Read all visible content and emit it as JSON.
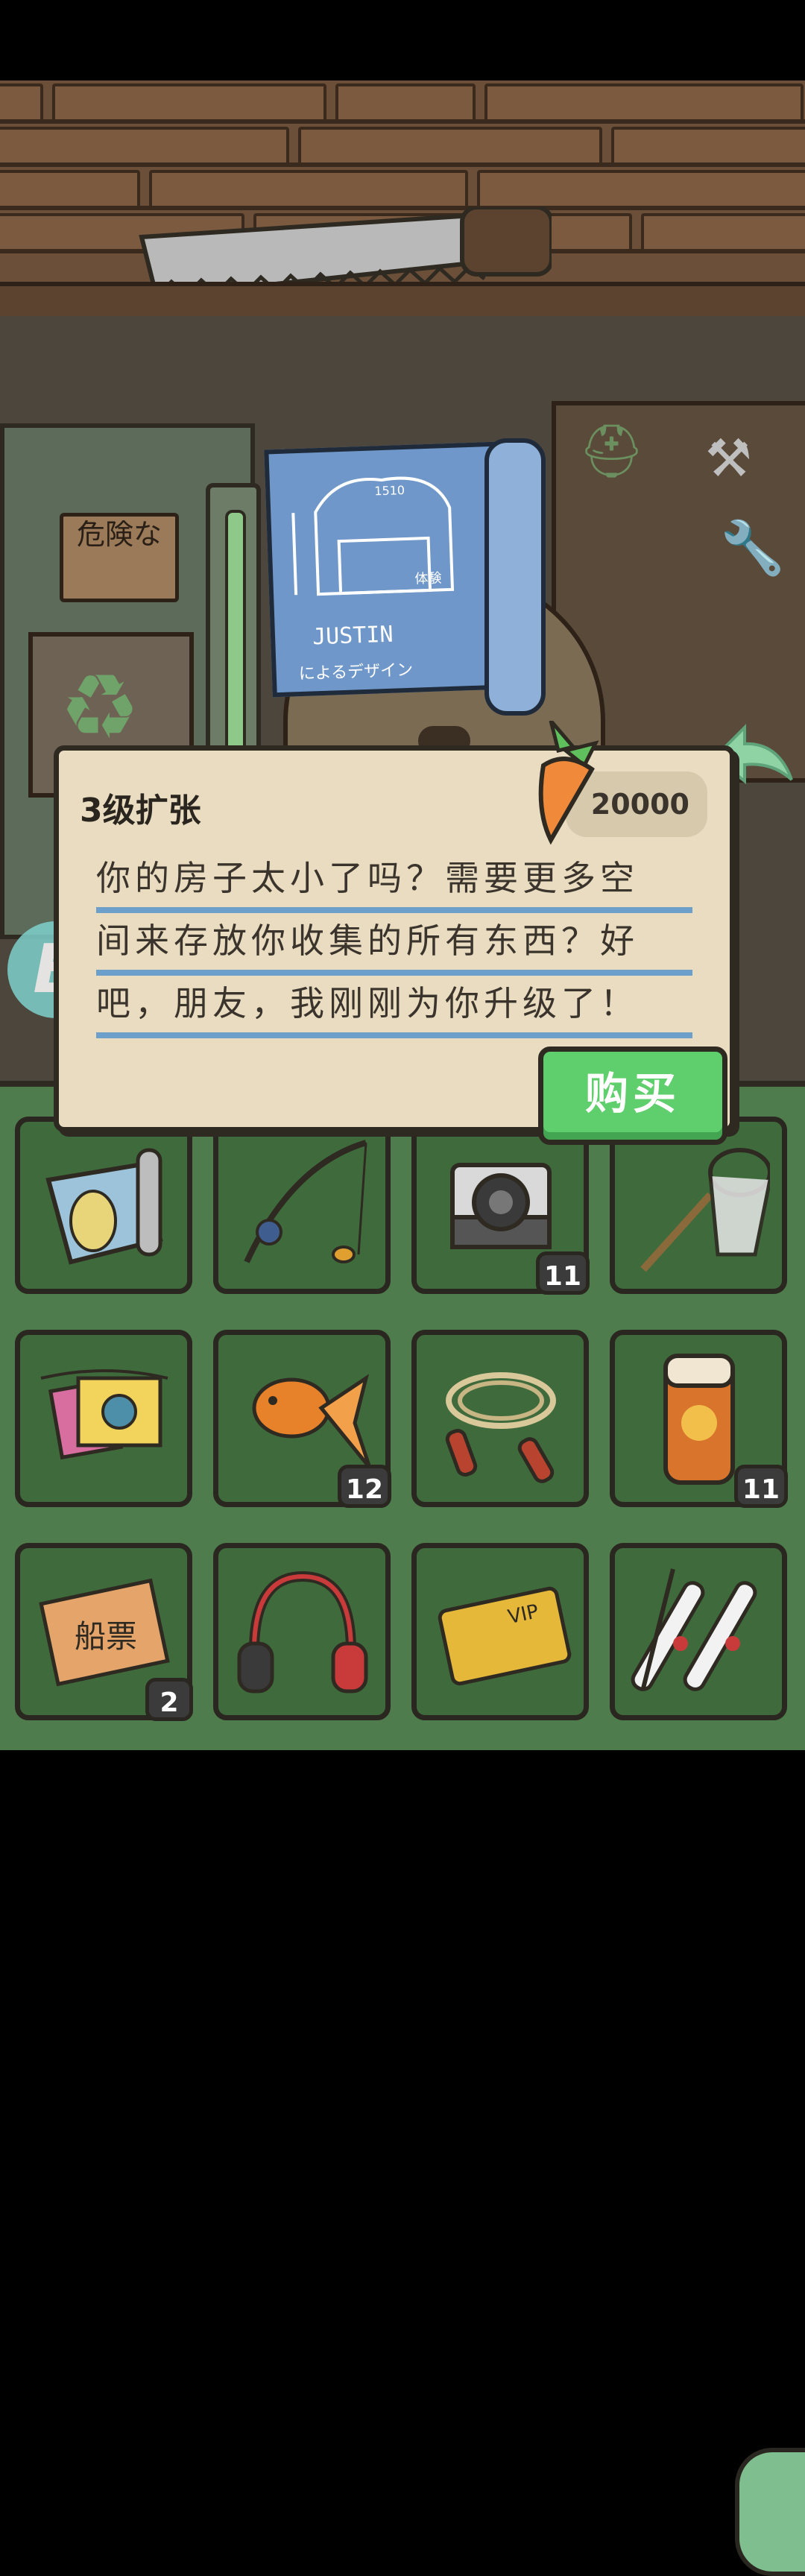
{
  "dialog": {
    "title": "3级扩张",
    "price": "20000",
    "description_lines": [
      "你的房子太小了吗？需要更多空",
      "间来存放你收集的所有东西？好",
      "吧，朋友，我刚刚为你升级了！"
    ],
    "buy_label": "购买"
  },
  "scene": {
    "danger_sign_text": "危険な",
    "blueprint_title": "JUSTIN",
    "blueprint_subtitle": "によるデザイン",
    "blueprint_label_1": "1510",
    "blueprint_note": "体験"
  },
  "overlay": {
    "e_badge": "E"
  },
  "inventory": {
    "slots": [
      {
        "name": "map-scroll",
        "icon": "map-icon",
        "count": ""
      },
      {
        "name": "fishing-rod",
        "icon": "fishing-rod-icon",
        "count": ""
      },
      {
        "name": "instant-camera",
        "icon": "camera-icon",
        "count": "11"
      },
      {
        "name": "bug-net",
        "icon": "bug-net-icon",
        "count": ""
      },
      {
        "name": "bunting-flags",
        "icon": "bunting-icon",
        "count": ""
      },
      {
        "name": "goldfish",
        "icon": "goldfish-icon",
        "count": "12"
      },
      {
        "name": "jump-rope",
        "icon": "jump-rope-icon",
        "count": ""
      },
      {
        "name": "sunscreen",
        "icon": "sunscreen-icon",
        "count": "11"
      },
      {
        "name": "boat-ticket",
        "icon": "ticket-icon",
        "count": "2",
        "text": "船票"
      },
      {
        "name": "headphones",
        "icon": "headphones-icon",
        "count": ""
      },
      {
        "name": "vip-card",
        "icon": "vip-card-icon",
        "count": "",
        "text": "VIP"
      },
      {
        "name": "skis",
        "icon": "skis-icon",
        "count": ""
      }
    ]
  },
  "colors": {
    "dialog_bg": "#e9dcc0",
    "line_blue": "#6ca0cb",
    "buy_green": "#5fce6c",
    "inventory_green": "#4e7c4c",
    "slot_green": "#3f6b3c"
  }
}
